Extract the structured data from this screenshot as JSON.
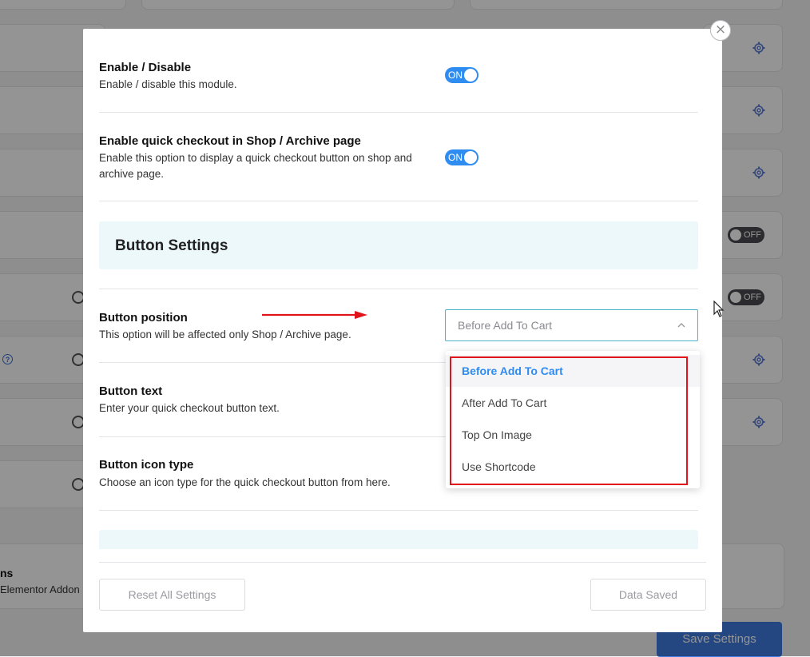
{
  "modal": {
    "close_symbol": "×",
    "rows": [
      {
        "title": "Enable / Disable",
        "desc": "Enable / disable this module.",
        "toggle_label": "ON"
      },
      {
        "title": "Enable quick checkout in Shop / Archive page",
        "desc_line1": "Enable this option to display a quick checkout button on shop and",
        "desc_line2": "archive page.",
        "toggle_label": "ON"
      }
    ],
    "section_title": "Button Settings",
    "button_position": {
      "title": "Button position",
      "desc": "This option will be affected only Shop / Archive page.",
      "selected_value": "Before Add To Cart"
    },
    "button_text": {
      "title": "Button text",
      "desc": "Enter your quick checkout button text."
    },
    "button_icon_type": {
      "title": "Button icon type",
      "desc": "Choose an icon type for the quick checkout button from here."
    },
    "footer": {
      "reset_label": "Reset All Settings",
      "saved_label": "Data Saved"
    }
  },
  "dropdown": {
    "options": [
      {
        "label": "Before Add To Cart",
        "selected": true
      },
      {
        "label": "After Add To Cart",
        "selected": false
      },
      {
        "label": "Top On Image",
        "selected": false
      },
      {
        "label": "Use Shortcode",
        "selected": false
      }
    ]
  },
  "background": {
    "toggle_off_label": "OFF",
    "help_symbol": "?",
    "partial_title": "ns",
    "partial_subtitle": "Elementor Addon",
    "save_button_label": "Save Settings"
  },
  "colors": {
    "accent": "#2f8cf0",
    "section_bg": "#ecf8fa",
    "highlight": "#e1141c"
  },
  "icons": [
    "close-icon",
    "gear-icon",
    "chevron-up-icon",
    "arrow-right-icon",
    "help-icon",
    "mouse-cursor-icon"
  ]
}
